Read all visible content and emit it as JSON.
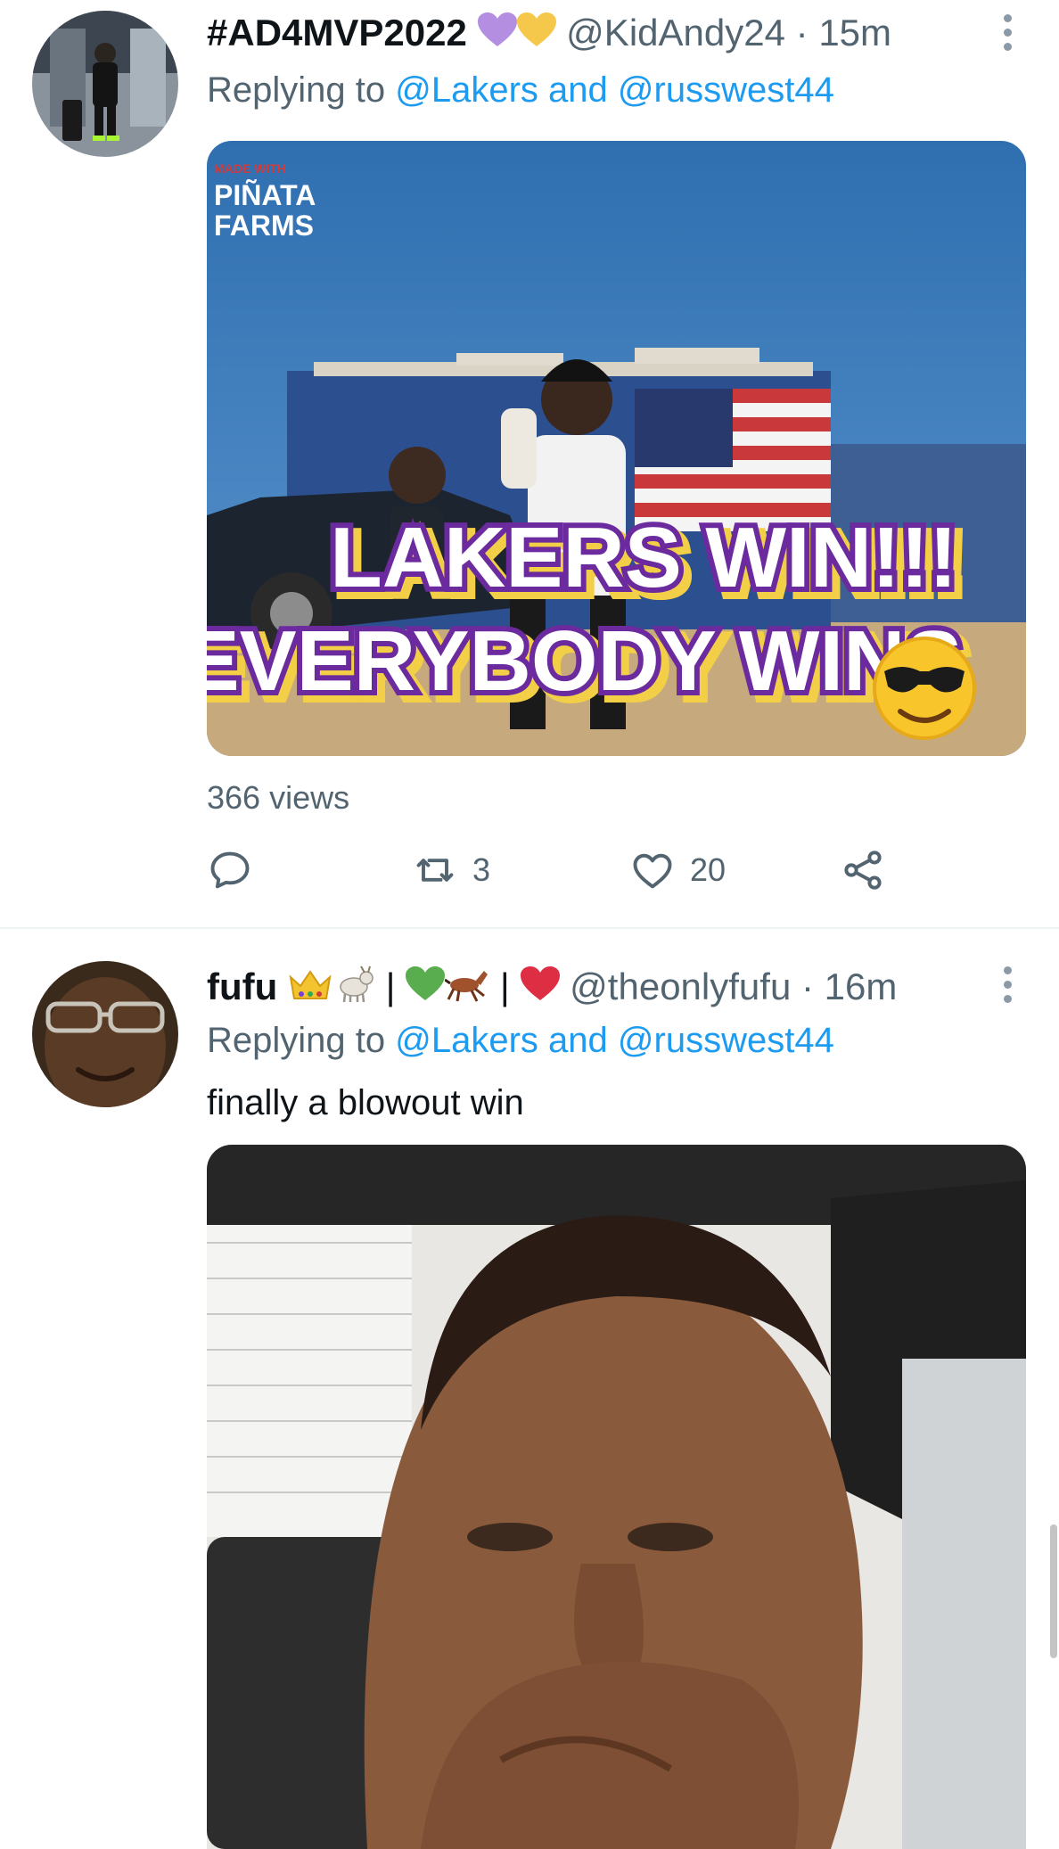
{
  "tweets": [
    {
      "display_name": "#AD4MVP2022",
      "handle": "@KidAndy24",
      "separator": "·",
      "time": "15m",
      "replying_prefix": "Replying to",
      "replying_to_1": "@Lakers",
      "replying_and": "and",
      "replying_to_2": "@russwest44",
      "media": {
        "watermark_top": "MADE WITH",
        "watermark_brand_1": "PIÑATA",
        "watermark_brand_2": "FARMS",
        "caption_line_1": "LAKERS WIN!!!",
        "caption_line_2": "EVERYBODY WINS"
      },
      "views": "366 views",
      "retweets": "3",
      "likes": "20"
    },
    {
      "display_name": "fufu",
      "handle": "@theonlyfufu",
      "separator": "·",
      "time": "16m",
      "replying_prefix": "Replying to",
      "replying_to_1": "@Lakers",
      "replying_and": "and",
      "replying_to_2": "@russwest44",
      "text": "finally a blowout win"
    }
  ],
  "colors": {
    "link": "#1d9bf0",
    "secondary": "#536471",
    "primary": "#0f1419"
  }
}
